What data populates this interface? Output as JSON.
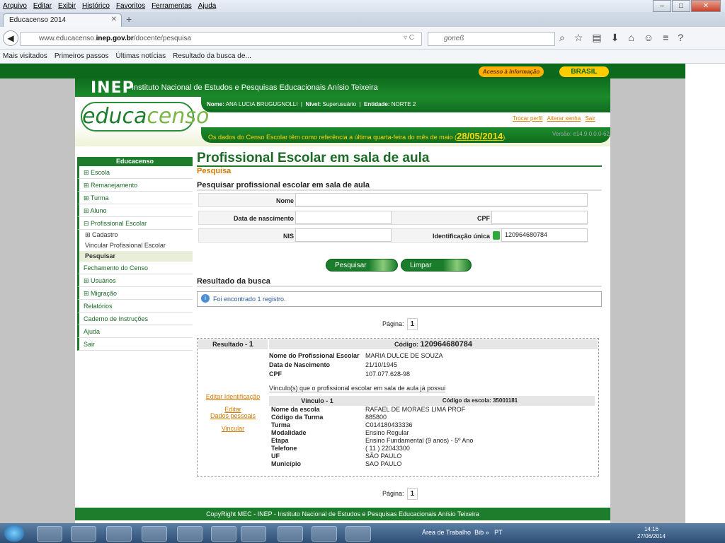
{
  "browser": {
    "menu": [
      "Arquivo",
      "Editar",
      "Exibir",
      "Histórico",
      "Favoritos",
      "Ferramentas",
      "Ajuda"
    ],
    "tab_title": "Educacenso 2014",
    "url_prefix": "www.educacenso.",
    "url_domain": "inep.gov.br",
    "url_path": "/docente/pesquisa",
    "search_text": "goneß",
    "bookmarks": [
      "Mais visitados",
      "Primeiros passos",
      "Últimas notícias",
      "Resultado da busca de..."
    ]
  },
  "site": {
    "acesso": "Acesso à Informação",
    "brasil": "BRASIL",
    "inep_logo": "INEP",
    "inep_name": "Instituto Nacional de Estudos e Pesquisas Educacionais Anísio Teixeira",
    "user_label": "Nome:",
    "user_name": "ANA LUCIA BRUGUGNOLLI",
    "nivel_label": "Nível:",
    "nivel": "Superusuário",
    "entidade_label": "Entidade:",
    "entidade": "NORTE 2",
    "logo_a": "educa",
    "logo_b": "censo",
    "links": [
      "Trocar perfil",
      "Alterar senha",
      "Sair"
    ],
    "notice": "Os dados do Censo Escolar têm como referência a última quarta-feira do mês de maio (",
    "notice_date": "28/05/2014",
    "notice_end": ").",
    "versao": "Versão: e14.9.0.0.0-62",
    "footer": "CopyRight MEC - INEP - Instituto Nacional de Estudos e Pesquisas Educacionais Anísio Teixeira"
  },
  "sidebar": {
    "title": "Educacenso",
    "items": [
      "⊞ Escola",
      "⊞ Remanejamento",
      "⊞ Turma",
      "⊞ Aluno",
      "⊟ Profissional Escolar"
    ],
    "subitems": [
      "⊞ Cadastro",
      "Vincular Profissional Escolar",
      "Pesquisar"
    ],
    "items2": [
      "Fechamento do Censo",
      "⊞ Usuários",
      "⊞ Migração",
      "Relatórios",
      "Caderno de Instruções",
      "Ajuda",
      "Sair"
    ]
  },
  "main": {
    "title": "Profissional Escolar em sala de aula",
    "section": "Pesquisa",
    "subtitle": "Pesquisar profissional escolar em sala de aula",
    "form": {
      "nome_label": "Nome",
      "nome_value": "",
      "nasc_label": "Data de nascimento",
      "nasc_value": "",
      "cpf_label": "CPF",
      "cpf_value": "",
      "nis_label": "NIS",
      "nis_value": "",
      "id_label": "Identificação única",
      "id_value": "120964680784"
    },
    "btn_pesquisar": "Pesquisar",
    "btn_limpar": "Limpar",
    "resultado_title": "Resultado da busca",
    "found": "Foi encontrado 1 registro.",
    "pagina_label": "Página:",
    "pagina": "1"
  },
  "result": {
    "label": "Resultado - ",
    "num": "1",
    "codigo_label": "Código: ",
    "codigo": "120964680784",
    "fields": [
      {
        "k": "Nome do Profissional Escolar",
        "v": "MARIA DULCE DE SOUZA"
      },
      {
        "k": "Data de Nascimento",
        "v": "21/10/1945"
      },
      {
        "k": "CPF",
        "v": "107.077.628-98"
      }
    ],
    "vinculos_text": "Vínculo(s) que o profissional escolar em sala de aula já possui",
    "vinculo_head": "Vínculo - 1",
    "escola_head": "Código da escola: 35001181",
    "vinc_fields": [
      {
        "k": "Nome da escola",
        "v": "RAFAEL DE MORAES LIMA PROF"
      },
      {
        "k": "Código da Turma",
        "v": "885800"
      },
      {
        "k": "Turma",
        "v": "C014180433336"
      },
      {
        "k": "Modalidade",
        "v": "Ensino Regular"
      },
      {
        "k": "Etapa",
        "v": "Ensino Fundamental (9 anos) - 5º Ano"
      },
      {
        "k": "Telefone",
        "v": "( 11 ) 22043300"
      },
      {
        "k": "UF",
        "v": "SÃO PAULO"
      },
      {
        "k": "Município",
        "v": "SAO PAULO"
      }
    ],
    "links": [
      "Editar Identificação",
      "Editar",
      "Dados pessoais",
      "Vincular"
    ]
  },
  "taskbar": {
    "area": "Área de Trabalho",
    "bib": "Bib",
    "lang": "PT",
    "time": "14:16",
    "date": "27/06/2014"
  }
}
